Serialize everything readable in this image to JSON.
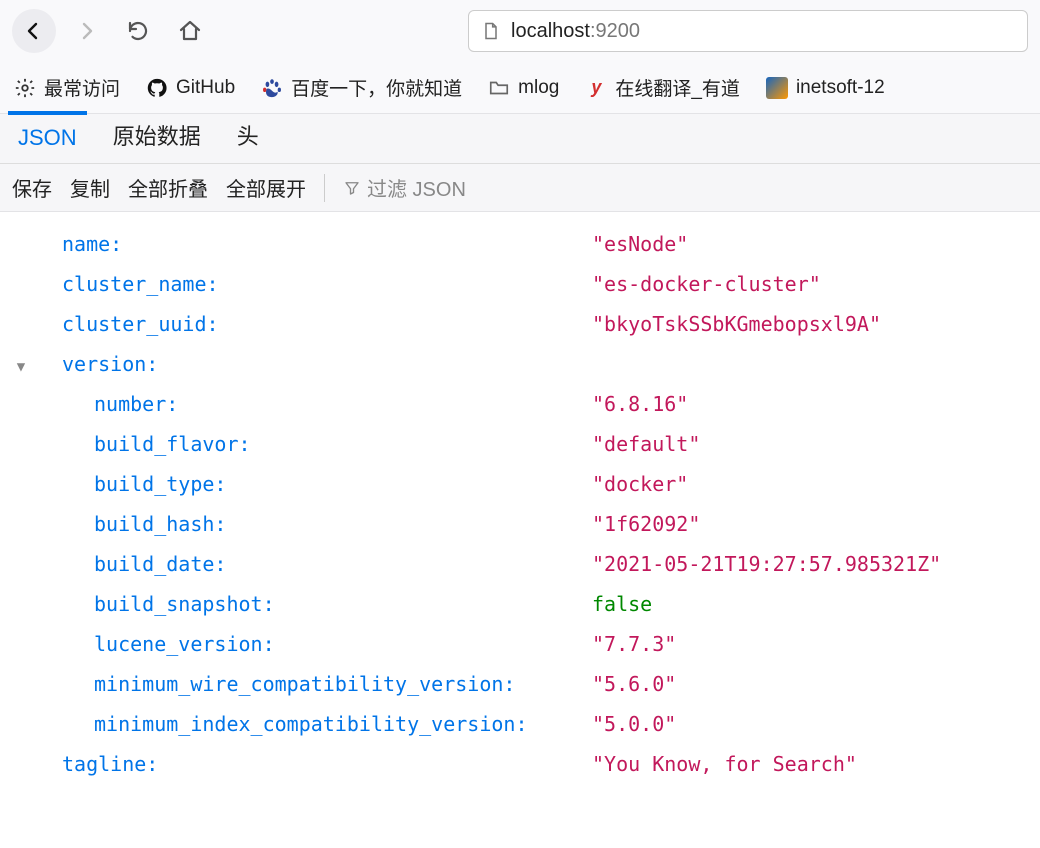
{
  "address": {
    "host": "localhost",
    "port": ":9200"
  },
  "bookmarks": [
    {
      "label": "最常访问",
      "icon": "gear"
    },
    {
      "label": "GitHub",
      "icon": "github"
    },
    {
      "label": "百度一下，你就知道",
      "icon": "baidu"
    },
    {
      "label": "mlog",
      "icon": "folder"
    },
    {
      "label": "在线翻译_有道",
      "icon": "youdao"
    },
    {
      "label": "inetsoft-12",
      "icon": "inetsoft"
    }
  ],
  "viewerTabs": {
    "json": "JSON",
    "raw": "原始数据",
    "headers": "头"
  },
  "viewerToolbar": {
    "save": "保存",
    "copy": "复制",
    "collapseAll": "全部折叠",
    "expandAll": "全部展开",
    "filterPlaceholder": "过滤 JSON"
  },
  "json": {
    "flat": [
      {
        "key": "name",
        "value": "\"esNode\"",
        "type": "str"
      },
      {
        "key": "cluster_name",
        "value": "\"es-docker-cluster\"",
        "type": "str"
      },
      {
        "key": "cluster_uuid",
        "value": "\"bkyoTskSSbKGmebopsxl9A\"",
        "type": "str"
      }
    ],
    "versionKey": "version",
    "version": [
      {
        "key": "number",
        "value": "\"6.8.16\"",
        "type": "str"
      },
      {
        "key": "build_flavor",
        "value": "\"default\"",
        "type": "str"
      },
      {
        "key": "build_type",
        "value": "\"docker\"",
        "type": "str"
      },
      {
        "key": "build_hash",
        "value": "\"1f62092\"",
        "type": "str"
      },
      {
        "key": "build_date",
        "value": "\"2021-05-21T19:27:57.985321Z\"",
        "type": "str"
      },
      {
        "key": "build_snapshot",
        "value": "false",
        "type": "bool"
      },
      {
        "key": "lucene_version",
        "value": "\"7.7.3\"",
        "type": "str"
      },
      {
        "key": "minimum_wire_compatibility_version",
        "value": "\"5.6.0\"",
        "type": "str"
      },
      {
        "key": "minimum_index_compatibility_version",
        "value": "\"5.0.0\"",
        "type": "str"
      }
    ],
    "taglineKey": "tagline",
    "taglineValue": "\"You Know, for Search\""
  }
}
